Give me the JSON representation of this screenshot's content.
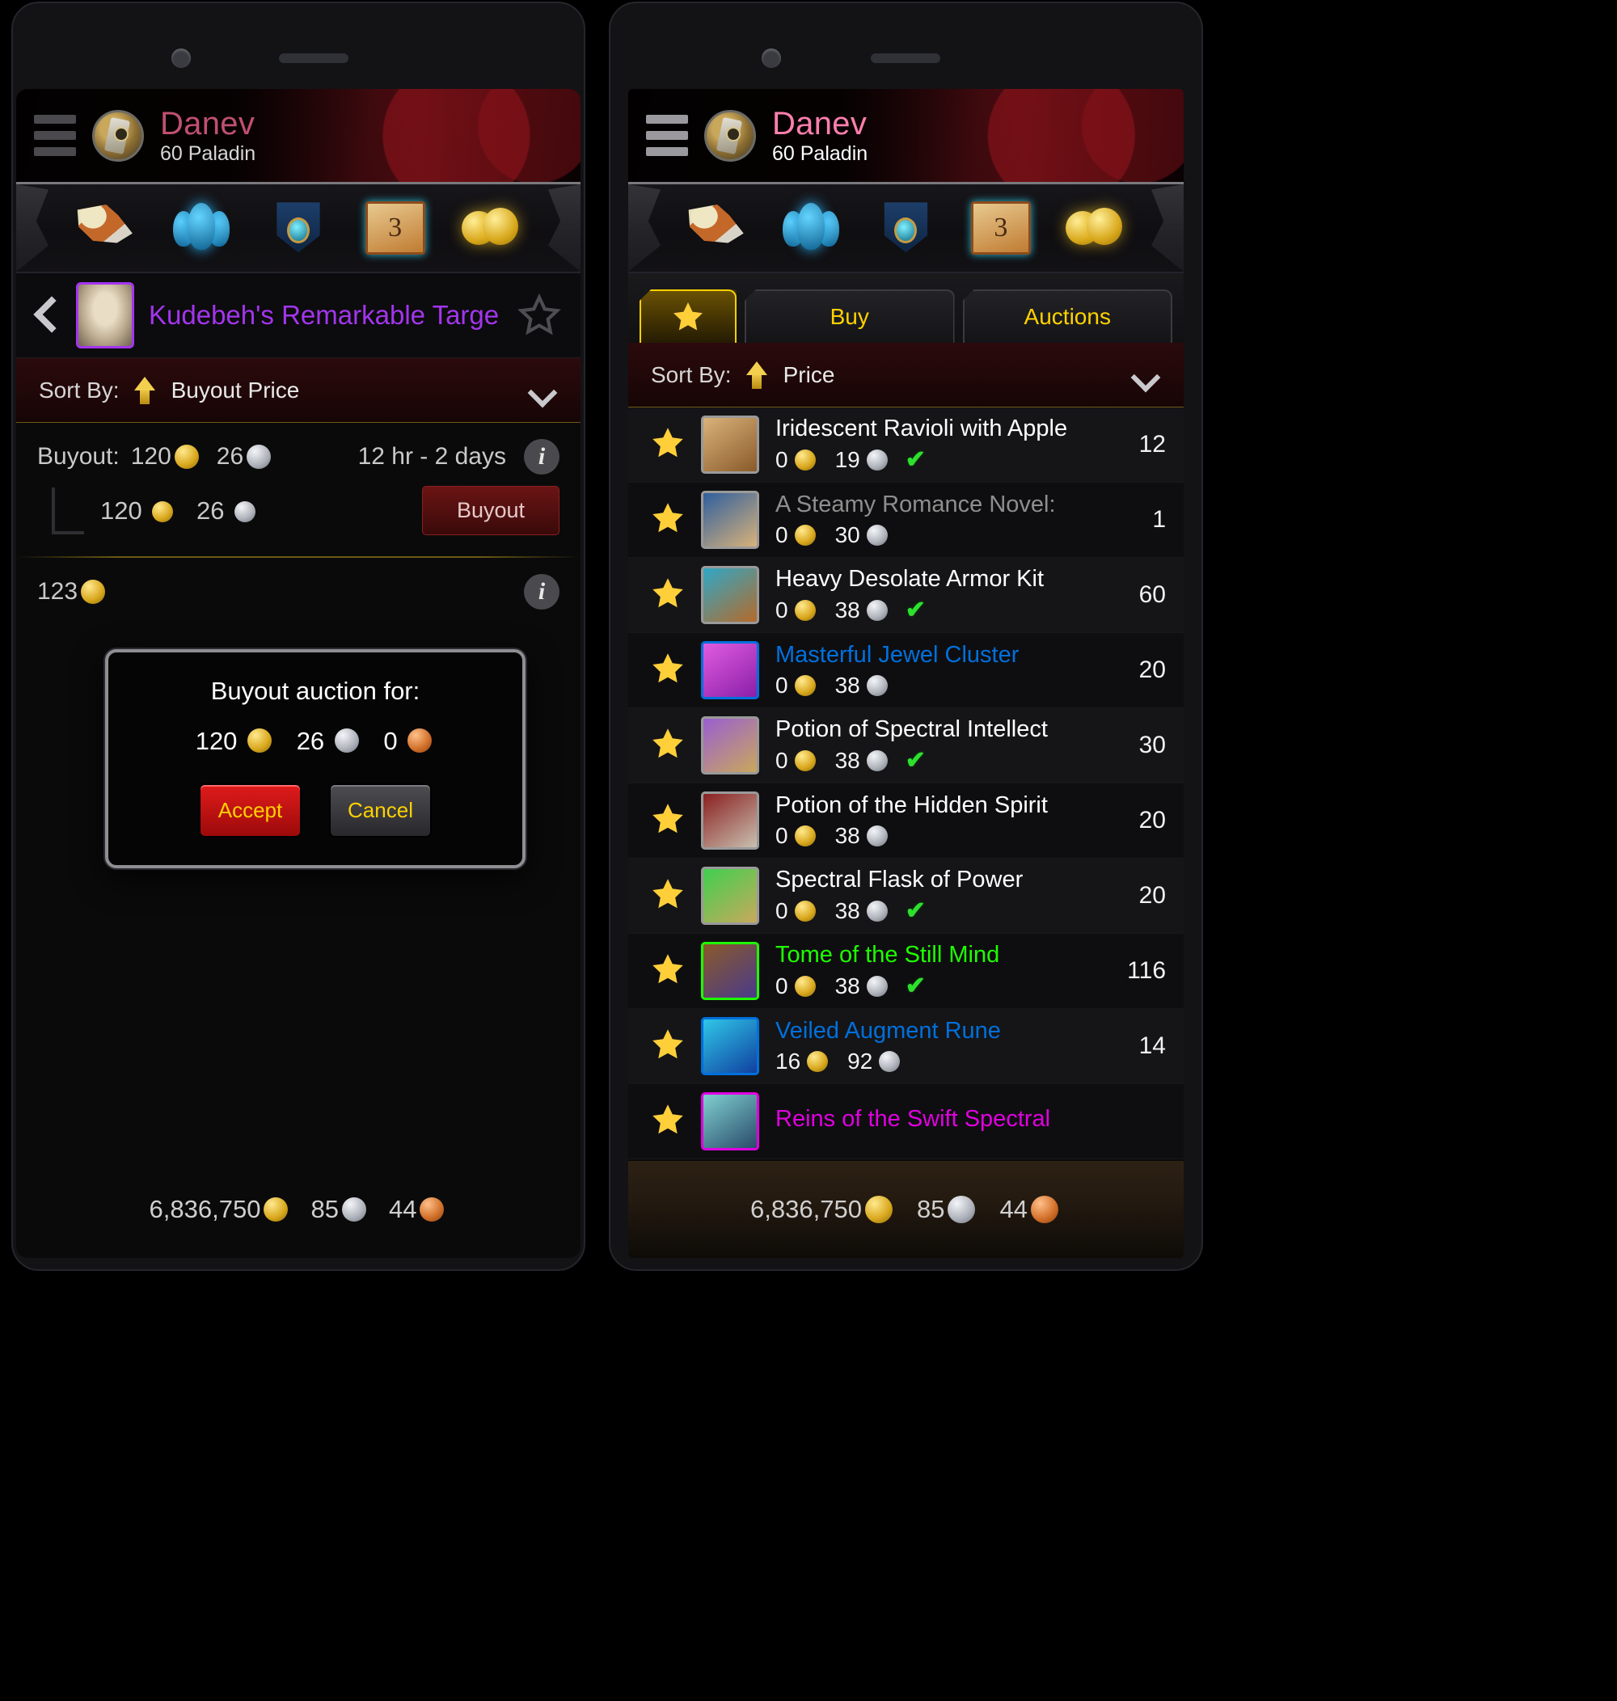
{
  "character": {
    "name": "Danev",
    "level_class": "60 Paladin"
  },
  "toolbar": {
    "icons": [
      {
        "name": "horn-icon",
        "label": "Quest Horn"
      },
      {
        "name": "group-icon",
        "label": "Group Finder"
      },
      {
        "name": "tabard-icon",
        "label": "Guild"
      },
      {
        "name": "book-icon",
        "label": "Mail"
      },
      {
        "name": "coins-icon",
        "label": "Auction House"
      }
    ]
  },
  "left_panel": {
    "detail": {
      "back_label": "Back",
      "item_name": "Kudebeh's Remarkable Targe",
      "item_quality_color": "#a335ee",
      "favorite_label": "Favorite"
    },
    "sort": {
      "label": "Sort By:",
      "value": "Buyout Price",
      "direction": "ascending"
    },
    "auction_rows": [
      {
        "label": "Buyout:",
        "gold": "120",
        "silver": "26",
        "duration": "12 hr - 2 days",
        "bid_gold": "120",
        "bid_silver": "26",
        "buyout_button": "Buyout"
      },
      {
        "label": "123"
      }
    ],
    "modal": {
      "title": "Buyout auction for:",
      "gold": "120",
      "silver": "26",
      "copper": "0",
      "accept_label": "Accept",
      "cancel_label": "Cancel"
    },
    "money": {
      "gold": "6,836,750",
      "silver": "85",
      "copper": "44"
    }
  },
  "right_panel": {
    "tabs": [
      {
        "id": "favorites",
        "label": "",
        "icon": "star-icon",
        "active": true
      },
      {
        "id": "buy",
        "label": "Buy",
        "active": false
      },
      {
        "id": "auctions",
        "label": "Auctions",
        "active": false
      }
    ],
    "sort": {
      "label": "Sort By:",
      "value": "Price",
      "direction": "ascending"
    },
    "listings": [
      {
        "name": "Iridescent Ravioli with Apple",
        "color": "#ffffff",
        "border": "#9a9a9a",
        "gold": "0",
        "silver": "19",
        "owned": true,
        "qty": "12",
        "icon_colors": [
          "#d9b27a",
          "#8a5a2a"
        ]
      },
      {
        "name": "A Steamy Romance Novel:",
        "color": "#8e8e8e",
        "border": "#9a9a9a",
        "gold": "0",
        "silver": "30",
        "owned": false,
        "qty": "1",
        "icon_colors": [
          "#2f5f9e",
          "#d9b27a"
        ]
      },
      {
        "name": "Heavy Desolate Armor Kit",
        "color": "#ffffff",
        "border": "#9a9a9a",
        "gold": "0",
        "silver": "38",
        "owned": true,
        "qty": "60",
        "icon_colors": [
          "#2fa8c7",
          "#b56a2a"
        ]
      },
      {
        "name": "Masterful Jewel Cluster",
        "color": "#0070dd",
        "border": "#0070dd",
        "gold": "0",
        "silver": "38",
        "owned": false,
        "qty": "20",
        "icon_colors": [
          "#e05ce0",
          "#8a1fa8"
        ]
      },
      {
        "name": "Potion of Spectral Intellect",
        "color": "#ffffff",
        "border": "#9a9a9a",
        "gold": "0",
        "silver": "38",
        "owned": true,
        "qty": "30",
        "icon_colors": [
          "#9a5fd0",
          "#c9a85c"
        ]
      },
      {
        "name": "Potion of the Hidden Spirit",
        "color": "#ffffff",
        "border": "#9a9a9a",
        "gold": "0",
        "silver": "38",
        "owned": false,
        "qty": "20",
        "icon_colors": [
          "#8a2020",
          "#c9c0b0"
        ]
      },
      {
        "name": "Spectral Flask of Power",
        "color": "#ffffff",
        "border": "#9a9a9a",
        "gold": "0",
        "silver": "38",
        "owned": true,
        "qty": "20",
        "icon_colors": [
          "#3fd04f",
          "#c9a85c"
        ]
      },
      {
        "name": "Tome of the Still Mind",
        "color": "#1eff00",
        "border": "#1eff00",
        "gold": "0",
        "silver": "38",
        "owned": true,
        "qty": "116",
        "icon_colors": [
          "#8a5a2a",
          "#4a3a8a"
        ]
      },
      {
        "name": "Veiled Augment Rune",
        "color": "#0070dd",
        "border": "#0070dd",
        "gold": "16",
        "silver": "92",
        "owned": false,
        "qty": "14",
        "icon_colors": [
          "#2fc7e8",
          "#1040a0"
        ]
      },
      {
        "name": "Reins of the Swift Spectral",
        "color": "#e000e0",
        "border": "#e000e0",
        "gold": "",
        "silver": "",
        "owned": false,
        "qty": "",
        "icon_colors": [
          "#7fd0d0",
          "#2a4a6a"
        ]
      }
    ],
    "money": {
      "gold": "6,836,750",
      "silver": "85",
      "copper": "44"
    }
  }
}
